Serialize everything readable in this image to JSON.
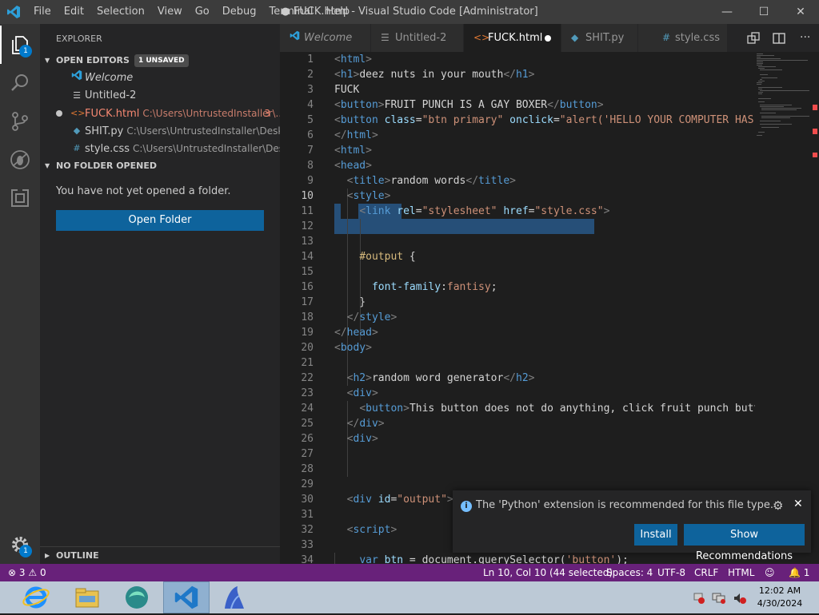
{
  "titlebar": {
    "menu": [
      "File",
      "Edit",
      "Selection",
      "View",
      "Go",
      "Debug",
      "Terminal",
      "Help"
    ],
    "title": "● FUCK.html - Visual Studio Code [Administrator]"
  },
  "activity": {
    "explorer_badge": "1",
    "settings_badge": "1"
  },
  "sidebar": {
    "title": "EXPLORER",
    "open_editors_label": "OPEN EDITORS",
    "unsaved_badge": "1 UNSAVED",
    "open_editors": [
      {
        "name": "Welcome",
        "path": "",
        "icon": "vscode-icon"
      },
      {
        "name": "Untitled-2",
        "path": "",
        "icon": "file-lines-icon"
      },
      {
        "name": "FUCK.html",
        "path": "C:\\Users\\UntrustedInstaller\\...",
        "problems": "3",
        "icon": "html-brackets-icon"
      },
      {
        "name": "SHIT.py",
        "path": "C:\\Users\\UntrustedInstaller\\Desktop",
        "icon": "python-icon"
      },
      {
        "name": "style.css",
        "path": "C:\\Users\\UntrustedInstaller\\Desktop",
        "icon": "hash-icon"
      }
    ],
    "no_folder_label": "NO FOLDER OPENED",
    "no_folder_text": "You have not yet opened a folder.",
    "open_folder_button": "Open Folder",
    "outline_label": "OUTLINE"
  },
  "tabs": [
    {
      "label": "Welcome",
      "icon": "vscode-icon"
    },
    {
      "label": "Untitled-2",
      "icon": "file-lines-icon"
    },
    {
      "label": "FUCK.html",
      "icon": "html-brackets-icon"
    },
    {
      "label": "SHIT.py",
      "icon": "python-icon"
    },
    {
      "label": "style.css",
      "icon": "hash-icon"
    }
  ],
  "editor": {
    "line_numbers": [
      "1",
      "2",
      "3",
      "4",
      "5",
      "6",
      "7",
      "8",
      "9",
      "10",
      "11",
      "12",
      "13",
      "14",
      "15",
      "16",
      "17",
      "18",
      "19",
      "20",
      "21",
      "22",
      "23",
      "24",
      "25",
      "26",
      "27",
      "28",
      "29",
      "30",
      "31",
      "32",
      "33",
      "34"
    ],
    "current_line": "10",
    "lines": [
      [
        [
          "t-br",
          "<"
        ],
        [
          "t-tag",
          "html"
        ],
        [
          "t-br",
          ">"
        ]
      ],
      [
        [
          "t-br",
          "<"
        ],
        [
          "t-tag",
          "h1"
        ],
        [
          "t-br",
          ">"
        ],
        [
          "t-txt",
          "deez nuts in your mouth"
        ],
        [
          "t-br",
          "</"
        ],
        [
          "t-tag",
          "h1"
        ],
        [
          "t-br",
          ">"
        ]
      ],
      [
        [
          "t-txt",
          "FUCK"
        ]
      ],
      [
        [
          "t-br",
          "<"
        ],
        [
          "t-tag",
          "button"
        ],
        [
          "t-br",
          ">"
        ],
        [
          "t-txt",
          "FRUIT PUNCH IS A GAY BOXER"
        ],
        [
          "t-br",
          "</"
        ],
        [
          "t-tag",
          "button"
        ],
        [
          "t-br",
          ">"
        ]
      ],
      [
        [
          "t-br",
          "<"
        ],
        [
          "t-tag",
          "button"
        ],
        [
          "t-txt",
          " "
        ],
        [
          "t-attr",
          "class"
        ],
        [
          "t-txt",
          "="
        ],
        [
          "t-str",
          "\"btn primary\""
        ],
        [
          "t-txt",
          " "
        ],
        [
          "t-attr",
          "onclick"
        ],
        [
          "t-txt",
          "="
        ],
        [
          "t-str",
          "\"alert('HELLO YOUR COMPUTER HAS"
        ]
      ],
      [
        [
          "t-br",
          "</"
        ],
        [
          "t-tag",
          "html"
        ],
        [
          "t-br",
          ">"
        ]
      ],
      [
        [
          "t-br",
          "<"
        ],
        [
          "t-tag",
          "html"
        ],
        [
          "t-br",
          ">"
        ]
      ],
      [
        [
          "t-br",
          "<"
        ],
        [
          "t-tag",
          "head"
        ],
        [
          "t-br",
          ">"
        ]
      ],
      [
        [
          "t-txt",
          "  "
        ],
        [
          "t-br",
          "<"
        ],
        [
          "t-tag",
          "title"
        ],
        [
          "t-br",
          ">"
        ],
        [
          "t-txt",
          "random words"
        ],
        [
          "t-br",
          "</"
        ],
        [
          "t-tag",
          "title"
        ],
        [
          "t-br",
          ">"
        ]
      ],
      [
        [
          "t-txt",
          "  "
        ],
        [
          "t-br",
          "<"
        ],
        [
          "t-tag",
          "style"
        ],
        [
          "t-br",
          ">"
        ]
      ],
      [
        [
          "t-txt",
          "    "
        ],
        [
          "t-br",
          "<"
        ],
        [
          "t-tag",
          "link"
        ],
        [
          "t-txt",
          " "
        ],
        [
          "t-attr",
          "rel"
        ],
        [
          "t-txt",
          "="
        ],
        [
          "t-str",
          "\"stylesheet\""
        ],
        [
          "t-txt",
          " "
        ],
        [
          "t-attr",
          "href"
        ],
        [
          "t-txt",
          "="
        ],
        [
          "t-str",
          "\"style.css\""
        ],
        [
          "t-br",
          ">"
        ]
      ],
      [],
      [],
      [
        [
          "t-txt",
          "    "
        ],
        [
          "t-sel",
          "#output"
        ],
        [
          "t-txt",
          " {"
        ]
      ],
      [],
      [
        [
          "t-txt",
          "      "
        ],
        [
          "t-attr",
          "font-family"
        ],
        [
          "t-txt",
          ":"
        ],
        [
          "t-str",
          "fantisy"
        ],
        [
          "t-txt",
          ";"
        ]
      ],
      [
        [
          "t-txt",
          "    }"
        ]
      ],
      [
        [
          "t-txt",
          "  "
        ],
        [
          "t-br",
          "</"
        ],
        [
          "t-tag",
          "style"
        ],
        [
          "t-br",
          ">"
        ]
      ],
      [
        [
          "t-br",
          "</"
        ],
        [
          "t-tag",
          "head"
        ],
        [
          "t-br",
          ">"
        ]
      ],
      [
        [
          "t-br",
          "<"
        ],
        [
          "t-tag",
          "body"
        ],
        [
          "t-br",
          ">"
        ]
      ],
      [],
      [
        [
          "t-txt",
          "  "
        ],
        [
          "t-br",
          "<"
        ],
        [
          "t-tag",
          "h2"
        ],
        [
          "t-br",
          ">"
        ],
        [
          "t-txt",
          "random word generator"
        ],
        [
          "t-br",
          "</"
        ],
        [
          "t-tag",
          "h2"
        ],
        [
          "t-br",
          ">"
        ]
      ],
      [
        [
          "t-txt",
          "  "
        ],
        [
          "t-br",
          "<"
        ],
        [
          "t-tag",
          "div"
        ],
        [
          "t-br",
          ">"
        ]
      ],
      [
        [
          "t-txt",
          "    "
        ],
        [
          "t-br",
          "<"
        ],
        [
          "t-tag",
          "button"
        ],
        [
          "t-br",
          ">"
        ],
        [
          "t-txt",
          "This button does not do anything, click fruit punch butto"
        ]
      ],
      [
        [
          "t-txt",
          "  "
        ],
        [
          "t-br",
          "</"
        ],
        [
          "t-tag",
          "div"
        ],
        [
          "t-br",
          ">"
        ]
      ],
      [
        [
          "t-txt",
          "  "
        ],
        [
          "t-br",
          "<"
        ],
        [
          "t-tag",
          "div"
        ],
        [
          "t-br",
          ">"
        ]
      ],
      [],
      [],
      [],
      [
        [
          "t-txt",
          "  "
        ],
        [
          "t-br",
          "<"
        ],
        [
          "t-tag",
          "div"
        ],
        [
          "t-txt",
          " "
        ],
        [
          "t-attr",
          "id"
        ],
        [
          "t-txt",
          "="
        ],
        [
          "t-str",
          "\"output\""
        ],
        [
          "t-br",
          ">"
        ]
      ],
      [],
      [
        [
          "t-txt",
          "  "
        ],
        [
          "t-br",
          "<"
        ],
        [
          "t-tag",
          "script"
        ],
        [
          "t-br",
          ">"
        ]
      ],
      [],
      [
        [
          "t-txt",
          "    "
        ],
        [
          "t-tag",
          "var"
        ],
        [
          "t-txt",
          " "
        ],
        [
          "t-attr",
          "btn"
        ],
        [
          "t-txt",
          " = document.querySelector("
        ],
        [
          "t-str",
          "'button'"
        ],
        [
          "t-txt",
          ");"
        ]
      ]
    ]
  },
  "notification": {
    "message": "The 'Python' extension is recommended for this file type.",
    "install": "Install",
    "show_recommendations": "Show Recommendations"
  },
  "status": {
    "errors": "3",
    "warnings": "0",
    "position": "Ln 10, Col 10 (44 selected)",
    "spaces": "Spaces: 4",
    "encoding": "UTF-8",
    "eol": "CRLF",
    "language": "HTML",
    "bell_count": "1"
  },
  "taskbar": {
    "time": "12:02 AM",
    "date": "4/30/2024"
  },
  "colors": {
    "statusbar": "#68217a",
    "activity_badge": "#007acc",
    "button": "#0e639c"
  }
}
